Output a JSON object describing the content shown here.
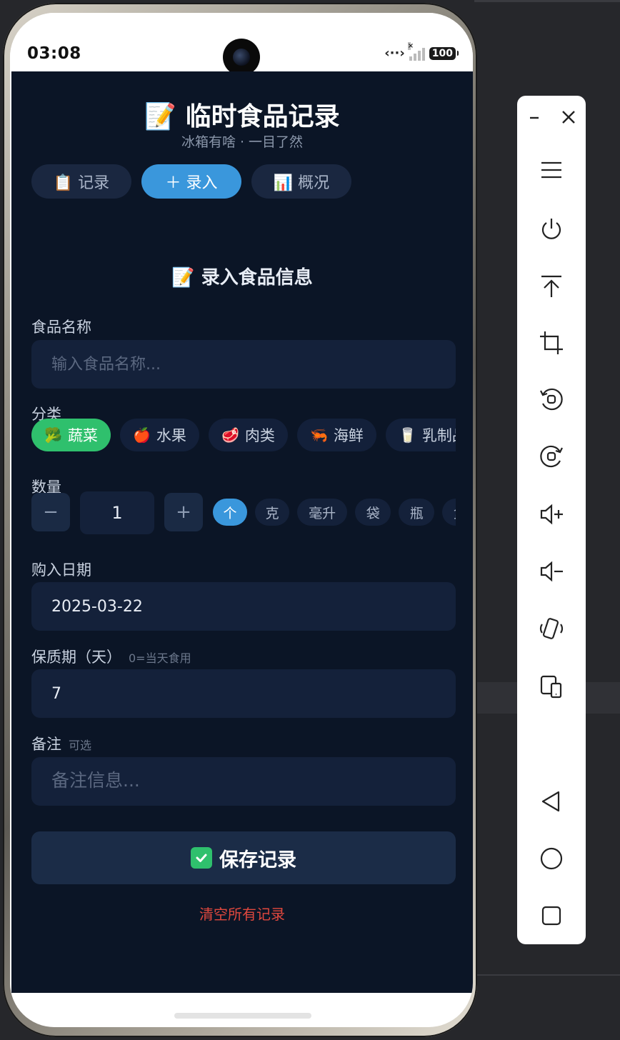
{
  "status": {
    "time": "03:08",
    "battery": "100",
    "net_icon": "code-arrows-icon"
  },
  "app": {
    "title": "📝 临时食品记录",
    "subtitle": "冰箱有啥 · 一目了然",
    "tabs": [
      {
        "label": "📋 记录",
        "active": false
      },
      {
        "label": "＋ 录入",
        "active": true
      },
      {
        "label": "📊 概况",
        "active": false
      }
    ]
  },
  "form": {
    "section_title": "📝 录入食品信息",
    "name": {
      "label": "食品名称",
      "placeholder": "输入食品名称..."
    },
    "category": {
      "label": "分类",
      "options": [
        {
          "emoji": "🥦",
          "label": "蔬菜",
          "active": true
        },
        {
          "emoji": "🍎",
          "label": "水果",
          "active": false
        },
        {
          "emoji": "🥩",
          "label": "肉类",
          "active": false
        },
        {
          "emoji": "🦐",
          "label": "海鲜",
          "active": false
        },
        {
          "emoji": "🥛",
          "label": "乳制品",
          "active": false
        }
      ]
    },
    "quantity": {
      "label": "数量",
      "minus": "−",
      "value": "1",
      "plus": "+",
      "units": [
        {
          "label": "个",
          "active": true
        },
        {
          "label": "克",
          "active": false
        },
        {
          "label": "毫升",
          "active": false
        },
        {
          "label": "袋",
          "active": false
        },
        {
          "label": "瓶",
          "active": false
        },
        {
          "label": "盒",
          "active": false
        }
      ]
    },
    "purchase_date": {
      "label": "购入日期",
      "value": "2025-03-22"
    },
    "shelf_life": {
      "label": "保质期（天）",
      "hint": "0=当天食用",
      "value": "7"
    },
    "note": {
      "label": "备注",
      "hint": "可选",
      "placeholder": "备注信息..."
    },
    "save_label": "保存记录",
    "clear_label": "清空所有记录"
  },
  "colors": {
    "screen_bg": "#0b1526",
    "accent_blue": "#3a97dc",
    "accent_green": "#2fc06d",
    "danger_red": "#e0483e"
  },
  "toolbar": {
    "icons": [
      "minimize-icon",
      "close-icon",
      "menu-icon",
      "power-icon",
      "to-top-icon",
      "crop-icon",
      "rotate-left-icon",
      "rotate-right-icon",
      "volume-up-icon",
      "volume-down-icon",
      "shake-icon",
      "device-switch-icon",
      "back-icon",
      "home-icon",
      "recents-icon"
    ]
  }
}
